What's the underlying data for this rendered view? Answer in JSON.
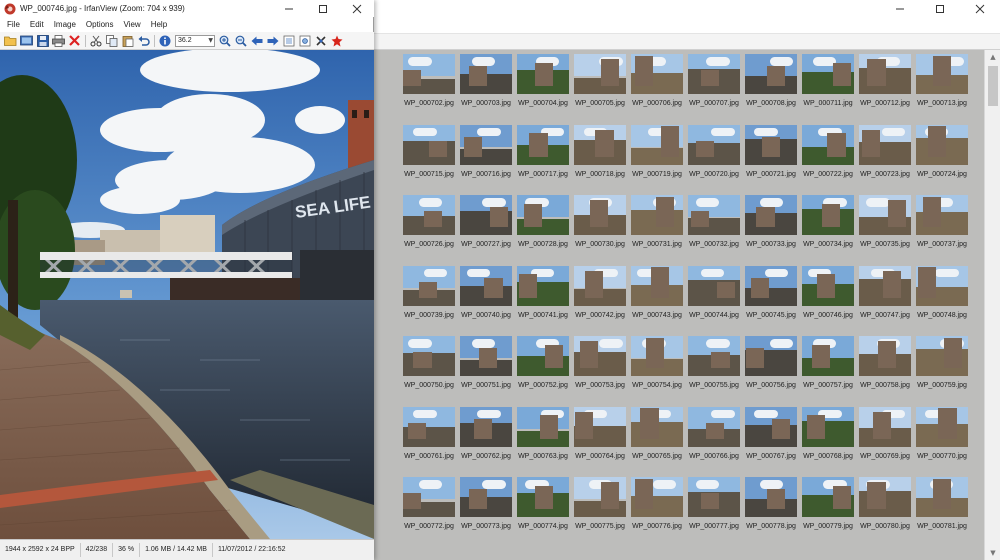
{
  "viewer": {
    "title": "WP_000746.jpg - IrfanView (Zoom: 704 x 939)",
    "menu": [
      "File",
      "Edit",
      "Image",
      "Options",
      "View",
      "Help"
    ],
    "zoom_value": "36.2",
    "toolbar_icons": [
      "open-folder-icon",
      "slideshow-icon",
      "save-icon",
      "print-icon",
      "delete-icon",
      "cut-icon",
      "copy-icon",
      "paste-icon",
      "undo-icon",
      "info-icon",
      "zoom-in-icon",
      "zoom-out-icon",
      "previous-icon",
      "next-icon",
      "fit-page-icon",
      "settings-icon",
      "effects-icon",
      "about-icon"
    ],
    "image_sign_text": "SEA LIFE",
    "status": [
      "1944 x 2592 x 24 BPP",
      "42/238",
      "36 %",
      "1.06 MB / 14.42 MB",
      "11/07/2012 / 22:16:52"
    ]
  },
  "thumbnails": {
    "rows": [
      [
        "WP_000702.jpg",
        "WP_000703.jpg",
        "WP_000704.jpg",
        "WP_000705.jpg",
        "WP_000706.jpg",
        "WP_000707.jpg",
        "WP_000708.jpg",
        "WP_000711.jpg",
        "WP_000712.jpg",
        "WP_000713.jpg"
      ],
      [
        "WP_000715.jpg",
        "WP_000716.jpg",
        "WP_000717.jpg",
        "WP_000718.jpg",
        "WP_000719.jpg",
        "WP_000720.jpg",
        "WP_000721.jpg",
        "WP_000722.jpg",
        "WP_000723.jpg",
        "WP_000724.jpg"
      ],
      [
        "WP_000726.jpg",
        "WP_000727.jpg",
        "WP_000728.jpg",
        "WP_000730.jpg",
        "WP_000731.jpg",
        "WP_000732.jpg",
        "WP_000733.jpg",
        "WP_000734.jpg",
        "WP_000735.jpg",
        "WP_000737.jpg"
      ],
      [
        "WP_000739.jpg",
        "WP_000740.jpg",
        "WP_000741.jpg",
        "WP_000742.jpg",
        "WP_000743.jpg",
        "WP_000744.jpg",
        "WP_000745.jpg",
        "WP_000746.jpg",
        "WP_000747.jpg",
        "WP_000748.jpg"
      ],
      [
        "WP_000750.jpg",
        "WP_000751.jpg",
        "WP_000752.jpg",
        "WP_000753.jpg",
        "WP_000754.jpg",
        "WP_000755.jpg",
        "WP_000756.jpg",
        "WP_000757.jpg",
        "WP_000758.jpg",
        "WP_000759.jpg"
      ],
      [
        "WP_000761.jpg",
        "WP_000762.jpg",
        "WP_000763.jpg",
        "WP_000764.jpg",
        "WP_000765.jpg",
        "WP_000766.jpg",
        "WP_000767.jpg",
        "WP_000768.jpg",
        "WP_000769.jpg",
        "WP_000770.jpg"
      ],
      [
        "WP_000772.jpg",
        "WP_000773.jpg",
        "WP_000774.jpg",
        "WP_000775.jpg",
        "WP_000776.jpg",
        "WP_000777.jpg",
        "WP_000778.jpg",
        "WP_000779.jpg",
        "WP_000780.jpg",
        "WP_000781.jpg"
      ]
    ]
  },
  "colors": {
    "grid_background": "#bdbdbb",
    "toolbar_background": "#f5f5f5"
  }
}
